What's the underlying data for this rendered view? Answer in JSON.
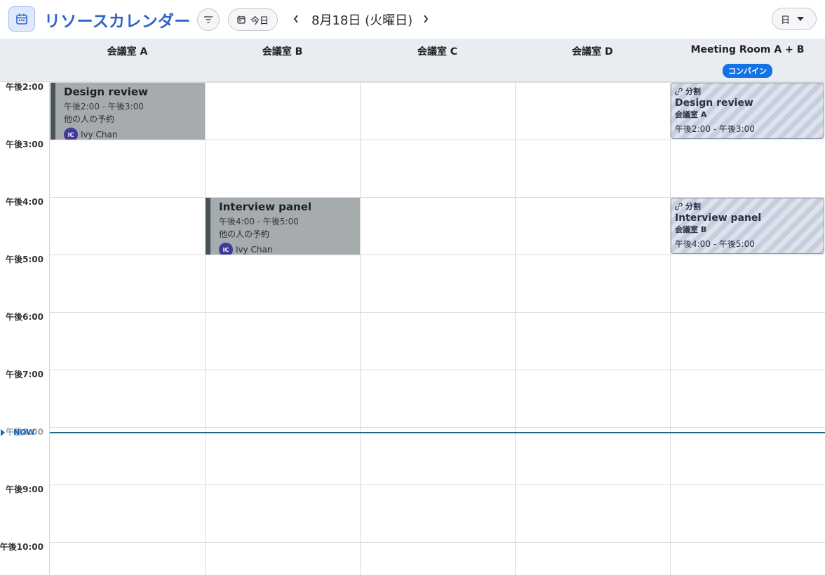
{
  "toolbar": {
    "app_icon": "calendar-icon",
    "title": "リソースカレンダー",
    "filter_icon": "filter-icon",
    "today_label": "今日",
    "date": "8月18日 (火曜日)",
    "view_mode": "日"
  },
  "columns": [
    {
      "name": "会議室 A"
    },
    {
      "name": "会議室 B"
    },
    {
      "name": "会議室 C"
    },
    {
      "name": "会議室 D"
    },
    {
      "name": "Meeting Room A + B",
      "badge": "コンバイン"
    }
  ],
  "time_labels": [
    "午後2:00",
    "午後3:00",
    "午後4:00",
    "午後5:00",
    "午後6:00",
    "午後7:00",
    "午後8:00",
    "午後9:00",
    "午後10:00"
  ],
  "now_label": "NOW",
  "events": [
    {
      "title": "Design review",
      "time": "午後2:00 - 午後3:00",
      "note": "他の人の予約",
      "user_initials": "IC",
      "user": "Ivy Chan"
    },
    {
      "title": "Interview panel",
      "time": "午後4:00 - 午後5:00",
      "note": "他の人の予約",
      "user_initials": "IC",
      "user": "Ivy Chan"
    }
  ],
  "split_events": [
    {
      "tag": "分割",
      "title": "Design review",
      "room": "会議室 A",
      "time": "午後2:00 - 午後3:00"
    },
    {
      "tag": "分割",
      "title": "Interview panel",
      "room": "会議室 B",
      "time": "午後4:00 - 午後5:00"
    }
  ],
  "colors": {
    "accent": "#2f63c5",
    "badge": "#1173e6",
    "event_bg": "#a6abad",
    "event_border": "#46535b",
    "now_line": "#1e6b86"
  }
}
